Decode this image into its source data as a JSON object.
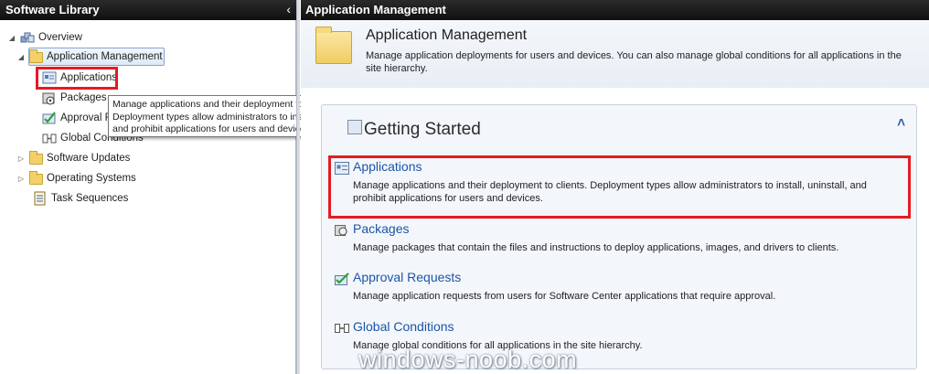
{
  "left_pane": {
    "title": "Software Library",
    "collapse_glyph": "‹",
    "tree": [
      {
        "label": "Overview",
        "icon": "overview-icon",
        "expanded": true
      },
      {
        "label": "Application Management",
        "icon": "folder-icon",
        "expanded": true,
        "selected": true
      },
      {
        "label": "Applications",
        "icon": "applications-icon"
      },
      {
        "label": "Packages",
        "icon": "packages-icon"
      },
      {
        "label": "Approval R",
        "icon": "approval-requests-icon"
      },
      {
        "label": "Global Conditions",
        "icon": "global-conditions-icon"
      },
      {
        "label": "Software Updates",
        "icon": "folder-icon",
        "expanded": false
      },
      {
        "label": "Operating Systems",
        "icon": "folder-icon",
        "expanded": false
      },
      {
        "label": "Task Sequences",
        "icon": "task-sequences-icon"
      }
    ],
    "tooltip": "Manage applications and their deployment to clients. Deployment types allow administrators to install, uninstall, and prohibit applications for users and devices."
  },
  "right_pane": {
    "title": "Application Management",
    "banner": {
      "title": "Application Management",
      "description": "Manage application deployments for users and devices. You can also manage global conditions for all applications in the site hierarchy."
    },
    "getting_started": {
      "title": "Getting Started",
      "collapse_glyph": "˄",
      "items": [
        {
          "label": "Applications",
          "description": "Manage applications and their deployment to clients. Deployment types allow administrators to install, uninstall, and prohibit applications for users and devices.",
          "icon": "applications-icon"
        },
        {
          "label": "Packages",
          "description": "Manage packages that contain the files and instructions to deploy applications, images, and drivers to clients.",
          "icon": "packages-icon"
        },
        {
          "label": "Approval Requests",
          "description": "Manage application requests from users for Software Center applications that require approval.",
          "icon": "approval-requests-icon"
        },
        {
          "label": "Global Conditions",
          "description": "Manage global conditions for all applications in the site hierarchy.",
          "icon": "global-conditions-icon"
        }
      ]
    }
  },
  "watermark": "windows-noob.com",
  "colors": {
    "header_bg": "#1a1a1a",
    "link": "#1c55a8",
    "highlight_red": "#e41b23",
    "selection_border": "#86a5c9",
    "folder": "#f4d06a"
  }
}
